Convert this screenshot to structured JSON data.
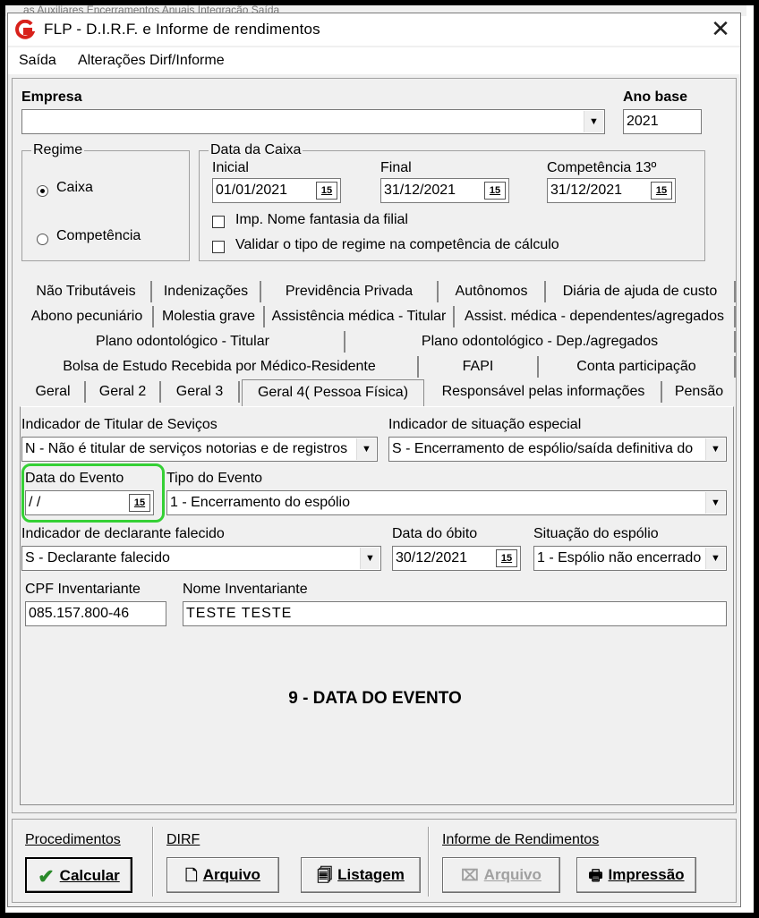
{
  "background_hint": "as Auxiliares   Encerramentos Anuais   Integração   Saída",
  "window": {
    "title": "FLP - D.I.R.F. e Informe de rendimentos",
    "close_glyph": "✕"
  },
  "menu": {
    "saida": "Saída",
    "alteracoes": "Alterações Dirf/Informe"
  },
  "empresa": {
    "label": "Empresa",
    "value": ""
  },
  "ano_base": {
    "label": "Ano base",
    "value": "2021"
  },
  "regime": {
    "caption": "Regime",
    "options": [
      "Caixa",
      "Competência"
    ],
    "selected": "Caixa"
  },
  "data_caixa": {
    "caption": "Data da Caixa",
    "inicial_label": "Inicial",
    "inicial_value": "01/01/2021",
    "final_label": "Final",
    "final_value": "31/12/2021",
    "comp13_label": "Competência 13º",
    "comp13_value": "31/12/2021",
    "chk_nome_fantasia": "Imp. Nome fantasia da filial",
    "chk_validar": "Validar o tipo de regime na competência de cálculo"
  },
  "tabs": {
    "row1": [
      "Não Tributáveis",
      "Indenizações",
      "Previdência Privada",
      "Autônomos",
      "Diária de ajuda de custo"
    ],
    "row2": [
      "Abono pecuniário",
      "Molestia grave",
      "Assistência médica - Titular",
      "Assist. médica - dependentes/agregados"
    ],
    "row3": [
      "Plano odontológico - Titular",
      "Plano odontológico - Dep./agregados"
    ],
    "row4": [
      "Bolsa de Estudo Recebida por Médico-Residente",
      "FAPI",
      "Conta participação"
    ],
    "row5": [
      "Geral",
      "Geral 2",
      "Geral 3",
      "Geral 4( Pessoa Física)",
      "Responsável pelas informações",
      "Pensão"
    ],
    "active": "Geral 4( Pessoa Física)"
  },
  "form": {
    "ind_titular_label": "Indicador de Titular de Seviços",
    "ind_titular_value": "N - Não é titular de serviços notorias e de registros",
    "ind_situacao_label": "Indicador de situação especial",
    "ind_situacao_value": "S - Encerramento de espólio/saída definitiva do",
    "data_evento_label": "Data do Evento",
    "data_evento_value": " / /",
    "tipo_evento_label": "Tipo do Evento",
    "tipo_evento_value": "1 - Encerramento do espólio",
    "ind_falecido_label": "Indicador de declarante falecido",
    "ind_falecido_value": "S - Declarante falecido",
    "data_obito_label": "Data do óbito",
    "data_obito_value": "30/12/2021",
    "situacao_espolio_label": "Situação do espólio",
    "situacao_espolio_value": "1 - Espólio não encerrado",
    "cpf_label": "CPF Inventariante",
    "cpf_value": "085.157.800-46",
    "nome_label": "Nome Inventariante",
    "nome_value": "TESTE TESTE",
    "cal_glyph": "15"
  },
  "annotation": "9 - DATA DO EVENTO",
  "bottom": {
    "procedimentos_label": "Procedimentos",
    "dirf_label": "DIRF",
    "informe_label": "Informe de Rendimentos",
    "calcular": "Calcular",
    "arquivo_dirf": "Arquivo",
    "listagem": "Listagem",
    "arquivo_informe": "Arquivo",
    "impressao": "Impressão"
  },
  "colors": {
    "highlight": "#35d035",
    "logo_red": "#d8211b"
  }
}
